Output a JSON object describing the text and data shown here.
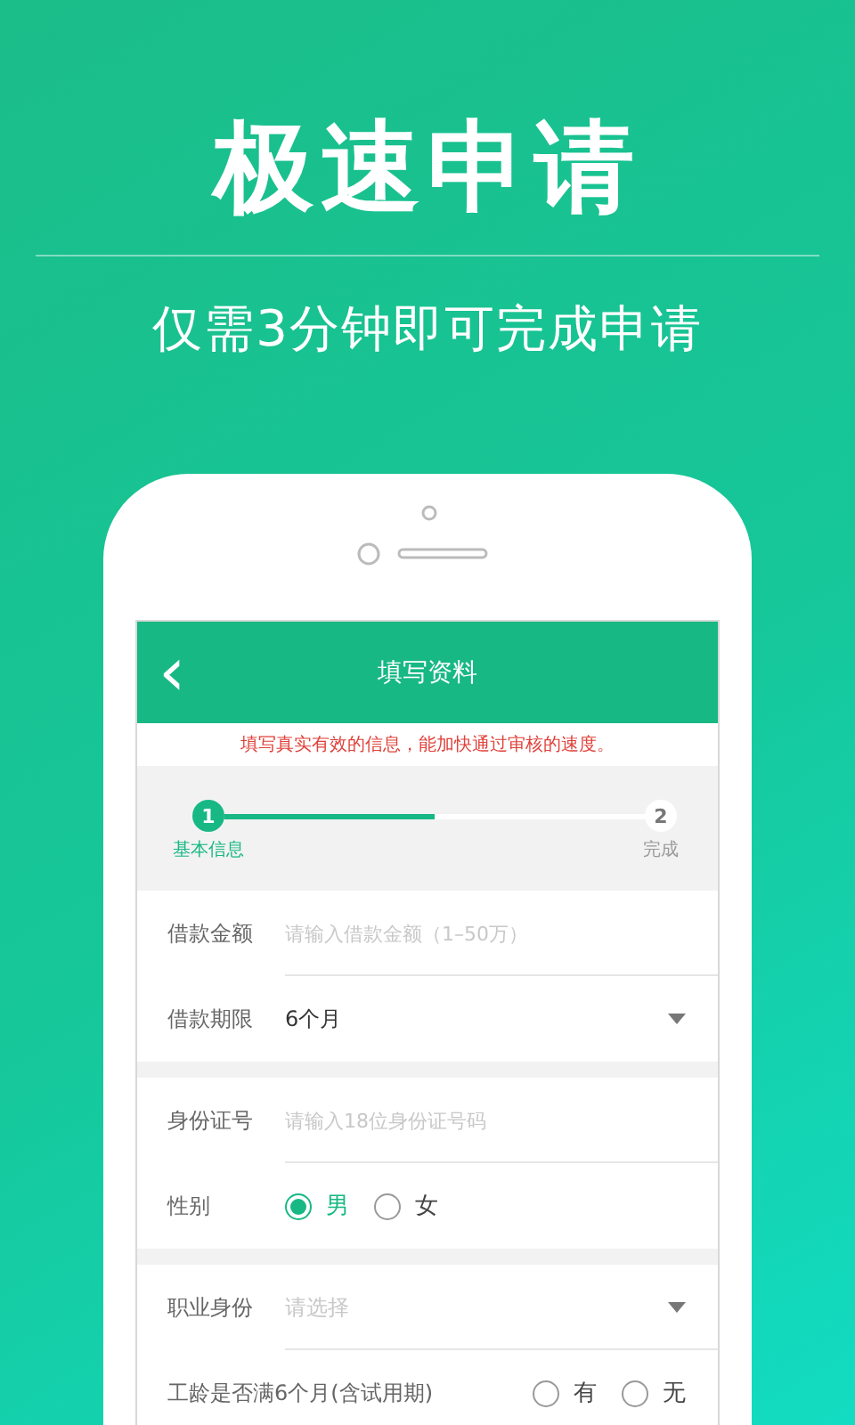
{
  "headline": "极速申请",
  "subtitle": "仅需3分钟即可完成申请",
  "screen": {
    "back": "‹",
    "title": "填写资料",
    "notice": "填写真实有效的信息，能加快通过审核的速度。",
    "steps": [
      {
        "number": "1",
        "label": "基本信息",
        "selected": true
      },
      {
        "number": "2",
        "label": "完成",
        "selected": false
      }
    ],
    "progress": {
      "level": 0.5
    },
    "sections": [
      {
        "rows": [
          {
            "kind": "input",
            "label": "借款金额",
            "placeholder": "请输入借款金额（1–50万）"
          },
          {
            "kind": "select",
            "label": "借款期限",
            "value": "6个月"
          }
        ]
      },
      {
        "rows": [
          {
            "kind": "input",
            "label": "身份证号",
            "placeholder": "请输入18位身份证号码"
          },
          {
            "kind": "radio",
            "label": "性别",
            "options": [
              {
                "label": "男",
                "selected": true
              },
              {
                "label": "女",
                "selected": false
              }
            ]
          }
        ]
      },
      {
        "rows": [
          {
            "kind": "select",
            "label": "职业身份",
            "placeholder": "请选择"
          },
          {
            "kind": "radio",
            "label": "工龄是否满6个月(含试用期)",
            "options": [
              {
                "label": "有",
                "selected": false
              },
              {
                "label": "无",
                "selected": false
              }
            ]
          }
        ]
      }
    ]
  }
}
